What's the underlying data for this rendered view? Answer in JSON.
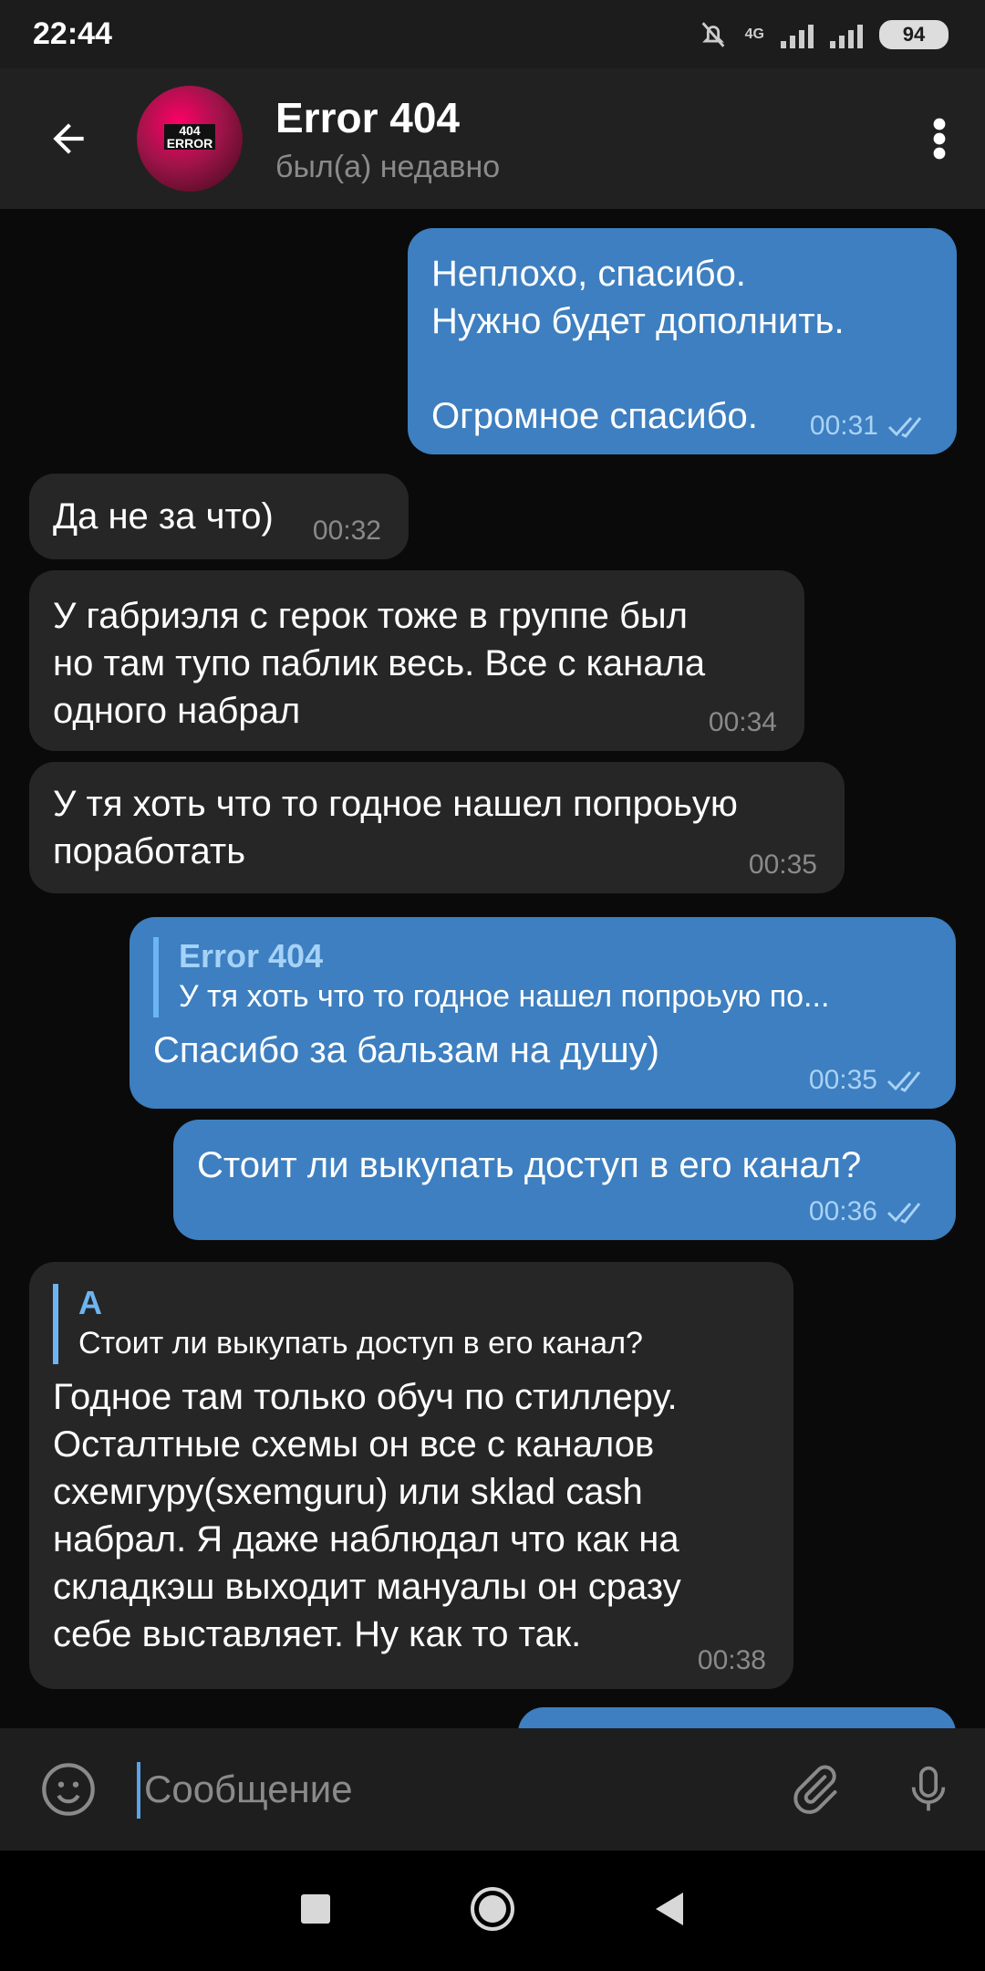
{
  "status_bar": {
    "time": "22:44",
    "network": "4G",
    "battery": "94"
  },
  "header": {
    "title": "Error 404",
    "status": "был(а) недавно",
    "avatar_text": "404\nERROR"
  },
  "messages": [
    {
      "dir": "out",
      "text": "Неплохо, спасибо.\nНужно будет дополнить.\n\nОгромное спасибо.",
      "time": "00:31",
      "read": true
    },
    {
      "dir": "in",
      "text": "Да не за что)",
      "time": "00:32"
    },
    {
      "dir": "in",
      "text": "У габриэля с герок тоже в группе был\nно там тупо паблик весь. Все с канала\nодного набрал",
      "time": "00:34"
    },
    {
      "dir": "in",
      "text": "У тя хоть что то годное нашел попроьую\nпоработать",
      "time": "00:35"
    },
    {
      "dir": "out",
      "reply_name": "Error 404",
      "reply_text": "У тя хоть что то годное нашел попроьую по...",
      "text": "Спасибо за бальзам на душу)",
      "time": "00:35",
      "read": true
    },
    {
      "dir": "out",
      "text": "Стоит ли выкупать доступ в его канал?",
      "time": "00:36",
      "read": true
    },
    {
      "dir": "in",
      "reply_name": "A",
      "reply_text": "Стоит ли выкупать доступ в его канал?",
      "text": "Годное там только обуч по стиллеру.\nОсталтные схемы он все с каналов\nсхемгуру(sxemguru) или sklad cash\nнабрал. Я даже наблюдал что как на\nскладкэш выходит мануалы он сразу\nсебе выставляет. Ну как то так.",
      "time": "00:38"
    }
  ],
  "input": {
    "placeholder": "Сообщение"
  }
}
